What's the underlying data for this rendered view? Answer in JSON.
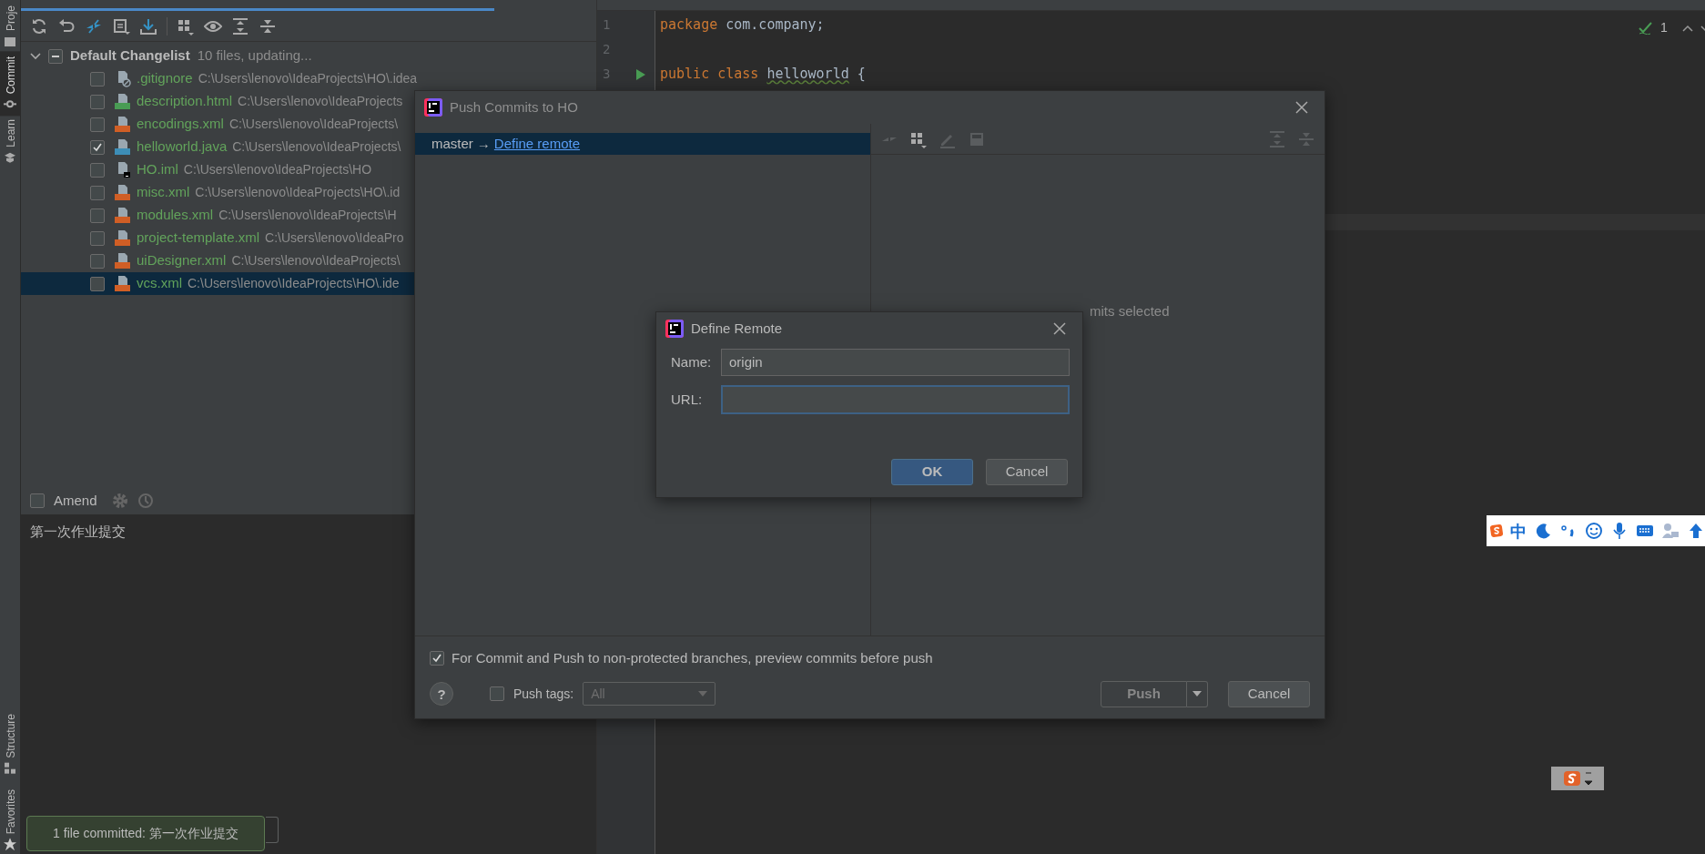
{
  "tool_strip": {
    "top_tabs": [
      {
        "label": "Proje",
        "selected": false
      },
      {
        "label": "Commit",
        "selected": true
      },
      {
        "label": "Learn",
        "selected": false
      }
    ],
    "bottom_tabs": [
      {
        "label": "Structure"
      },
      {
        "label": "Favorites"
      }
    ]
  },
  "commit_panel": {
    "changelist": {
      "name": "Default Changelist",
      "info": "10 files, updating...",
      "expanded": true,
      "indeterminate": true,
      "files": [
        {
          "name": ".gitignore",
          "path": "C:\\Users\\lenovo\\IdeaProjects\\HO\\.idea",
          "kind": "ignore",
          "checked": false,
          "selected": false
        },
        {
          "name": "description.html",
          "path": "C:\\Users\\lenovo\\IdeaProjects",
          "kind": "html",
          "checked": false,
          "selected": false
        },
        {
          "name": "encodings.xml",
          "path": "C:\\Users\\lenovo\\IdeaProjects\\",
          "kind": "xml",
          "checked": false,
          "selected": false
        },
        {
          "name": "helloworld.java",
          "path": "C:\\Users\\lenovo\\IdeaProjects\\",
          "kind": "java",
          "checked": true,
          "selected": false
        },
        {
          "name": "HO.iml",
          "path": "C:\\Users\\lenovo\\IdeaProjects\\HO",
          "kind": "iml",
          "checked": false,
          "selected": false
        },
        {
          "name": "misc.xml",
          "path": "C:\\Users\\lenovo\\IdeaProjects\\HO\\.id",
          "kind": "xml",
          "checked": false,
          "selected": false
        },
        {
          "name": "modules.xml",
          "path": "C:\\Users\\lenovo\\IdeaProjects\\H",
          "kind": "xml",
          "checked": false,
          "selected": false
        },
        {
          "name": "project-template.xml",
          "path": "C:\\Users\\lenovo\\IdeaPro",
          "kind": "xml",
          "checked": false,
          "selected": false
        },
        {
          "name": "uiDesigner.xml",
          "path": "C:\\Users\\lenovo\\IdeaProjects\\",
          "kind": "xml",
          "checked": false,
          "selected": false
        },
        {
          "name": "vcs.xml",
          "path": "C:\\Users\\lenovo\\IdeaProjects\\HO\\.ide",
          "kind": "xml",
          "checked": false,
          "selected": true
        }
      ]
    },
    "amend": {
      "label": "Amend",
      "checked": false
    },
    "message": "第一次作业提交"
  },
  "editor": {
    "lines": [
      {
        "number": "1",
        "runnable": false,
        "tokens": [
          {
            "text": "package",
            "kind": "keyword"
          },
          {
            "text": " com.company;",
            "kind": "plain"
          }
        ]
      },
      {
        "number": "2",
        "runnable": false
      },
      {
        "number": "3",
        "runnable": true,
        "tokens": [
          {
            "text": "public class ",
            "kind": "keyword"
          },
          {
            "text": "helloworld",
            "kind": "class"
          },
          {
            "text": " {",
            "kind": "plain"
          }
        ]
      }
    ],
    "inspection_count": "1"
  },
  "push_dialog": {
    "title": "Push Commits to HO",
    "branch": {
      "source": "master",
      "arrow": "→",
      "target": "Define remote",
      "selected": true
    },
    "empty_text": "mits selected",
    "preview_option": {
      "label": "For Commit and Push to non-protected branches, preview commits before push",
      "checked": true
    },
    "help": "?",
    "push_tags": {
      "label": "Push tags:",
      "checked": false,
      "value": "All",
      "disabled": true
    },
    "buttons": [
      {
        "label": "Push",
        "kind": "split"
      },
      {
        "label": "Cancel",
        "kind": "plain"
      }
    ]
  },
  "define_remote": {
    "title": "Define Remote",
    "fields": [
      {
        "label": "Name:",
        "value": "origin",
        "focused": false
      },
      {
        "label": "URL:",
        "focused": true
      }
    ],
    "buttons": [
      {
        "label": "OK",
        "default": true
      },
      {
        "label": "Cancel",
        "default": false
      }
    ]
  },
  "notification": {
    "text": "1 file committed: 第一次作业提交"
  },
  "ime_bar": {
    "mode": "中"
  }
}
